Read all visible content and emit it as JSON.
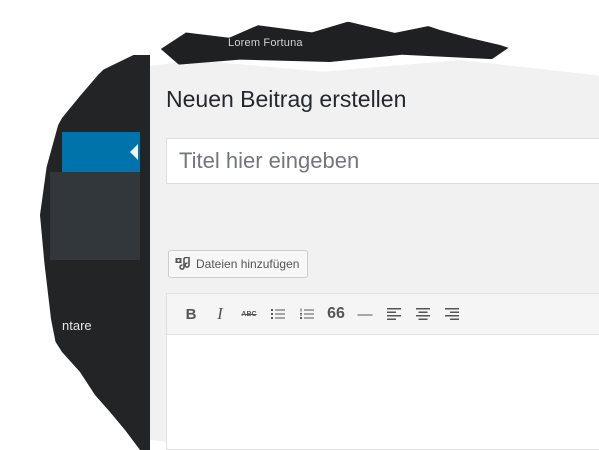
{
  "admin_bar": {
    "site_label": "Lorem Fortuna"
  },
  "sidebar": {
    "comments_label": "ntare"
  },
  "page": {
    "title": "Neuen Beitrag erstellen"
  },
  "title_field": {
    "placeholder": "Titel hier eingeben"
  },
  "media": {
    "add_label": "Dateien hinzufügen"
  },
  "toolbar": {
    "buttons": [
      {
        "name": "bold",
        "glyph": "B"
      },
      {
        "name": "italic",
        "glyph": "I"
      },
      {
        "name": "strikethrough",
        "glyph": "ABC"
      },
      {
        "name": "bulleted-list",
        "icon": "bulleted-list-icon"
      },
      {
        "name": "numbered-list",
        "icon": "numbered-list-icon"
      },
      {
        "name": "blockquote",
        "glyph": "66"
      },
      {
        "name": "horizontal-line",
        "glyph": "—"
      },
      {
        "name": "align-left",
        "icon": "align-left-icon"
      },
      {
        "name": "align-center",
        "icon": "align-center-icon"
      },
      {
        "name": "align-right",
        "icon": "align-right-icon"
      }
    ]
  },
  "colors": {
    "active_menu": "#0073aa",
    "sidebar": "#222426",
    "content_bg": "#f1f1f1"
  }
}
